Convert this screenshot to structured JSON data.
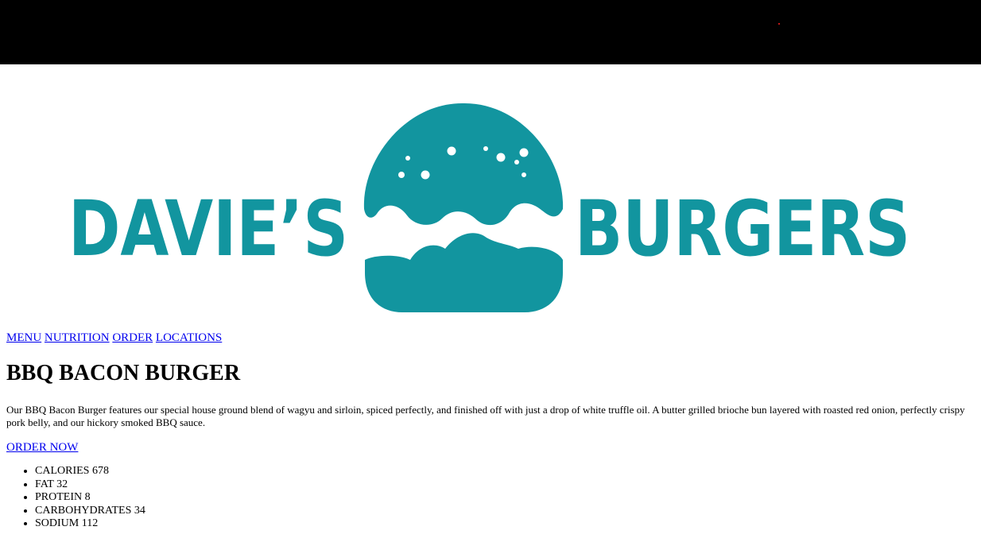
{
  "header": {
    "brand_color": "#12959f"
  },
  "logo": {
    "left_word": "DAVIE’S",
    "right_word": "BURGERS",
    "icon": "burger-icon"
  },
  "nav": {
    "items": [
      {
        "label": "MENU"
      },
      {
        "label": "NUTRITION"
      },
      {
        "label": "ORDER"
      },
      {
        "label": "LOCATIONS"
      }
    ]
  },
  "product": {
    "title": "BBQ BACON BURGER",
    "description": "Our BBQ Bacon Burger features our special house ground blend of wagyu and sirloin, spiced perfectly, and finished off with just a drop of white truffle oil. A butter grilled brioche bun layered with roasted red onion, perfectly crispy pork belly, and our hickory smoked BBQ sauce.",
    "order_label": "ORDER NOW"
  },
  "nutrition": {
    "items": [
      {
        "label": "CALORIES",
        "value": "678"
      },
      {
        "label": "FAT",
        "value": "32"
      },
      {
        "label": "PROTEIN",
        "value": "8"
      },
      {
        "label": "CARBOHYDRATES",
        "value": "34"
      },
      {
        "label": "SODIUM",
        "value": "112"
      }
    ]
  }
}
